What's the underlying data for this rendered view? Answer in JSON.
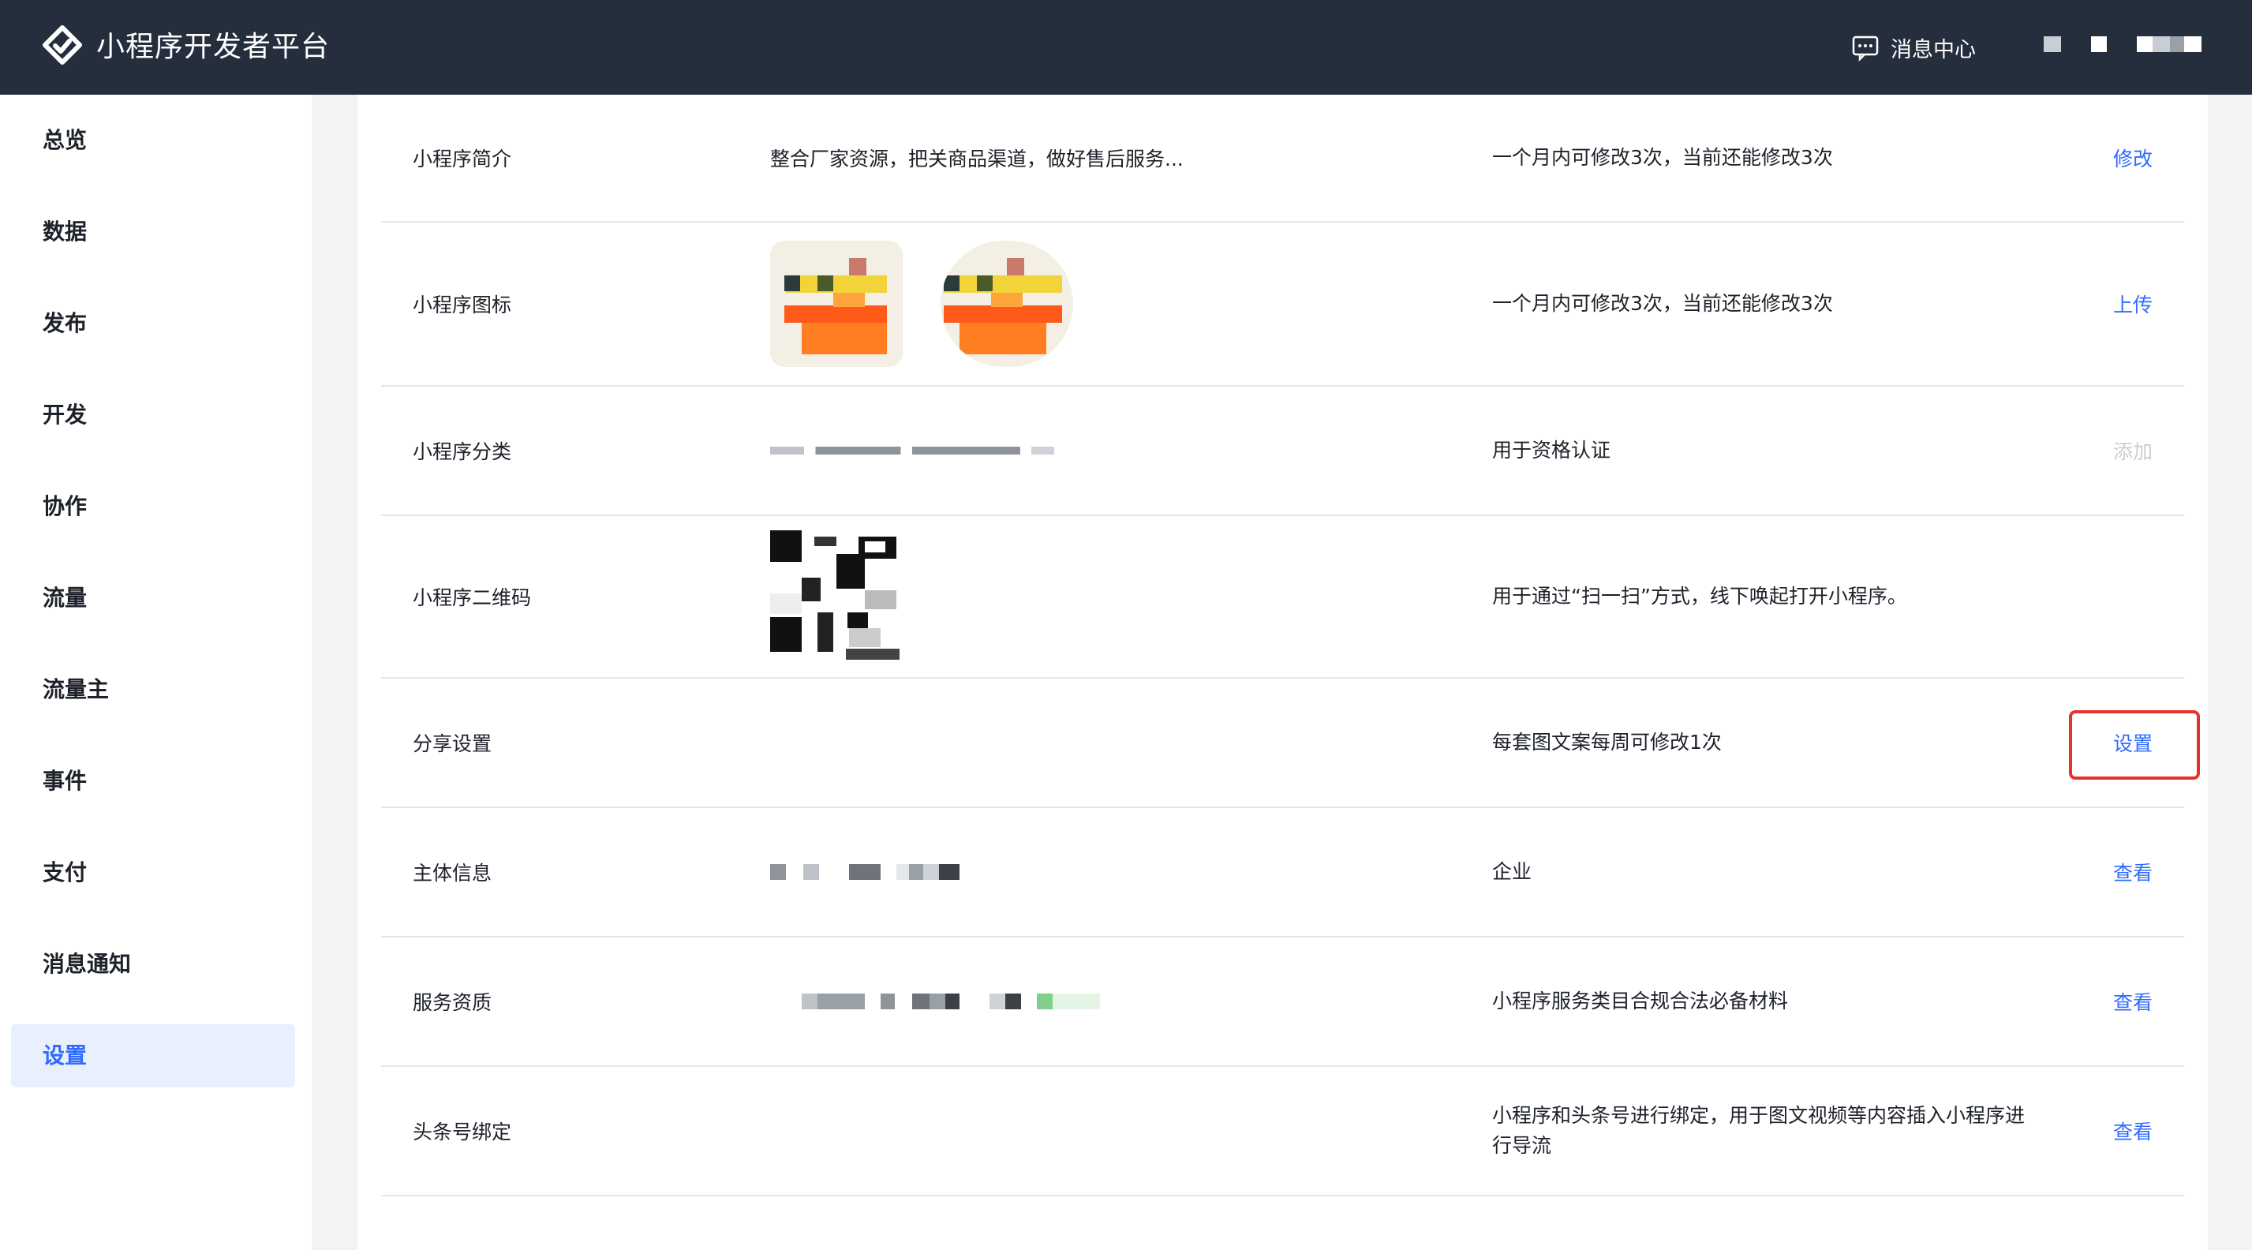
{
  "header": {
    "brand": "小程序开发者平台",
    "message_center": "消息中心"
  },
  "sidebar": {
    "items": [
      {
        "label": "总览"
      },
      {
        "label": "数据"
      },
      {
        "label": "发布"
      },
      {
        "label": "开发"
      },
      {
        "label": "协作"
      },
      {
        "label": "流量"
      },
      {
        "label": "流量主"
      },
      {
        "label": "事件"
      },
      {
        "label": "支付"
      },
      {
        "label": "消息通知"
      },
      {
        "label": "设置",
        "active": true
      }
    ]
  },
  "settings": {
    "rows": [
      {
        "label": "小程序简介",
        "value": "整合厂家资源，把关商品渠道，做好售后服务...",
        "desc": "一个月内可修改3次，当前还能修改3次",
        "action": "修改"
      },
      {
        "label": "小程序图标",
        "desc": "一个月内可修改3次，当前还能修改3次",
        "action": "上传"
      },
      {
        "label": "小程序分类",
        "desc": "用于资格认证",
        "action": "添加"
      },
      {
        "label": "小程序二维码",
        "desc": "用于通过“扫一扫”方式，线下唤起打开小程序。"
      },
      {
        "label": "分享设置",
        "desc": "每套图文案每周可修改1次",
        "action": "设置"
      },
      {
        "label": "主体信息",
        "desc": "企业",
        "action": "查看"
      },
      {
        "label": "服务资质",
        "desc": "小程序服务类目合规合法必备材料",
        "action": "查看"
      },
      {
        "label": "头条号绑定",
        "desc": "小程序和头条号进行绑定，用于图文视频等内容插入小程序进行导流",
        "action": "查看"
      }
    ]
  },
  "colors": {
    "header_bg": "#252e3c",
    "accent": "#2f6bff",
    "highlight": "#e5322d"
  }
}
